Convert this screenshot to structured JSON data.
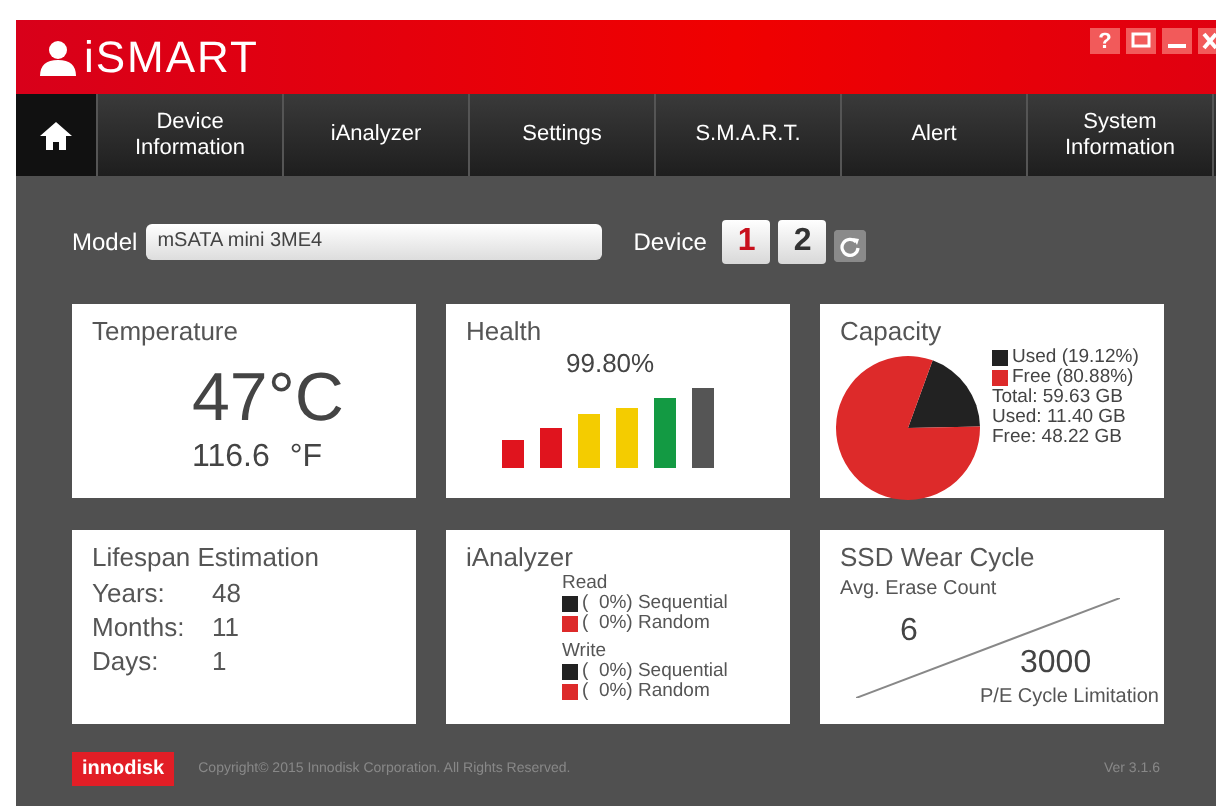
{
  "header": {
    "title": "iSMART",
    "help_button": "?"
  },
  "nav": [
    {
      "kind": "home",
      "selected": true
    },
    {
      "kind": "text",
      "label": "Device Information",
      "selected": false
    },
    {
      "kind": "text",
      "label": "iAnalyzer",
      "selected": false
    },
    {
      "kind": "text",
      "label": "Settings",
      "selected": false
    },
    {
      "kind": "text",
      "label": "S.M.A.R.T.",
      "selected": false
    },
    {
      "kind": "text",
      "label": "Alert",
      "selected": false
    },
    {
      "kind": "text",
      "label": "System Information",
      "selected": false
    }
  ],
  "model": {
    "label": "Model",
    "value": "mSATA mini 3ME4"
  },
  "device": {
    "label": "Device",
    "options": [
      {
        "label": "1",
        "selected": true
      },
      {
        "label": "2",
        "selected": false
      }
    ]
  },
  "temperature": {
    "title": "Temperature",
    "celsius": "47°C",
    "fahrenheit": "116.6",
    "fahrenheit_unit": "°F"
  },
  "health": {
    "title": "Health",
    "value": "99.80%"
  },
  "capacity": {
    "title": "Capacity",
    "legend": [
      {
        "label": "Used (19.12%)",
        "color": "#222222"
      },
      {
        "label": "Free (80.88%)",
        "color": "#dd2a2a"
      }
    ],
    "details": [
      "Total: 59.63 GB",
      "Used: 11.40 GB",
      "Free: 48.22 GB"
    ],
    "chart_data": {
      "type": "pie",
      "series": [
        {
          "values": [
            19.12,
            80.88
          ]
        }
      ]
    }
  },
  "lifespan": {
    "title": "Lifespan Estimation",
    "rows": [
      {
        "label": "Years:",
        "value": "48"
      },
      {
        "label": "Months:",
        "value": "11"
      },
      {
        "label": "Days:",
        "value": "1"
      }
    ]
  },
  "ianalyzer": {
    "title": "iAnalyzer",
    "groups": [
      {
        "heading": "Read",
        "items": [
          {
            "label": "(  0%) Sequential",
            "color": "#222222"
          },
          {
            "label": "(  0%) Random",
            "color": "#dd2a2a"
          }
        ]
      },
      {
        "heading": "Write",
        "items": [
          {
            "label": "(  0%) Sequential",
            "color": "#222222"
          },
          {
            "label": "(  0%) Random",
            "color": "#dd2a2a"
          }
        ]
      }
    ]
  },
  "wear": {
    "title": "SSD Wear Cycle",
    "subtitle": "Avg. Erase Count",
    "count": "6",
    "limit": "3000",
    "limit_label": "P/E Cycle Limitation"
  },
  "footer": {
    "brand": "innodisk",
    "copyright": "Copyright© 2015 Innodisk Corporation. All Rights Reserved.",
    "version": "Ver 3.1.6"
  }
}
